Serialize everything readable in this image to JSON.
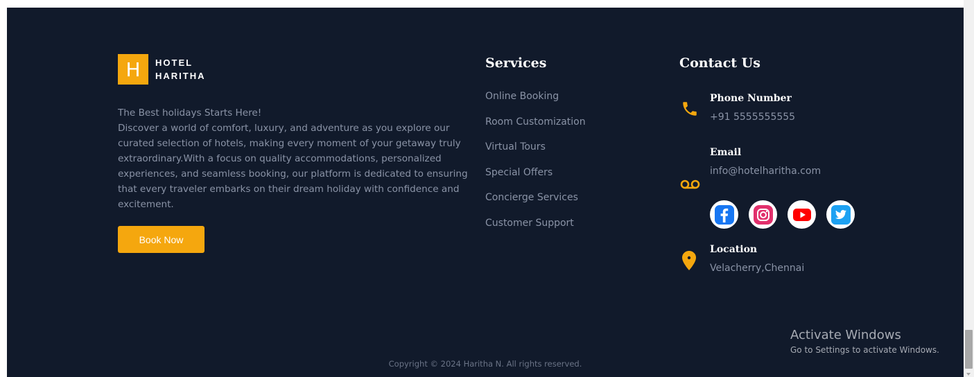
{
  "brand": {
    "logo_letter": "H",
    "name_line1": "HOTEL",
    "name_line2": "HARITHA",
    "accent_color": "#f5a70e",
    "background_color": "#111a2b"
  },
  "about": {
    "tagline": "The Best holidays Starts Here!",
    "description": "Discover a world of comfort, luxury, and adventure as you explore our curated selection of hotels, making every moment of your getaway truly extraordinary.With a focus on quality accommodations, personalized experiences, and seamless booking, our platform is dedicated to ensuring that every traveler embarks on their dream holiday with confidence and excitement."
  },
  "book_button": {
    "label": "Book Now"
  },
  "services": {
    "title": "Services",
    "items": [
      "Online Booking",
      "Room Customization",
      "Virtual Tours",
      "Special Offers",
      "Concierge Services",
      "Customer Support"
    ]
  },
  "contact": {
    "title": "Contact Us",
    "phone": {
      "label": "Phone Number",
      "value": "+91 5555555555",
      "icon": "phone-icon"
    },
    "email": {
      "label": "Email",
      "value": "info@hotelharitha.com",
      "icon": "voicemail-icon"
    },
    "social": [
      "facebook-icon",
      "instagram-icon",
      "youtube-icon",
      "twitter-icon"
    ],
    "location": {
      "label": "Location",
      "value": "Velacherry,Chennai",
      "icon": "location-pin-icon"
    }
  },
  "copyright": "Copyright © 2024 Haritha N. All rights reserved.",
  "windows_watermark": {
    "title": "Activate Windows",
    "subtitle": "Go to Settings to activate Windows."
  }
}
